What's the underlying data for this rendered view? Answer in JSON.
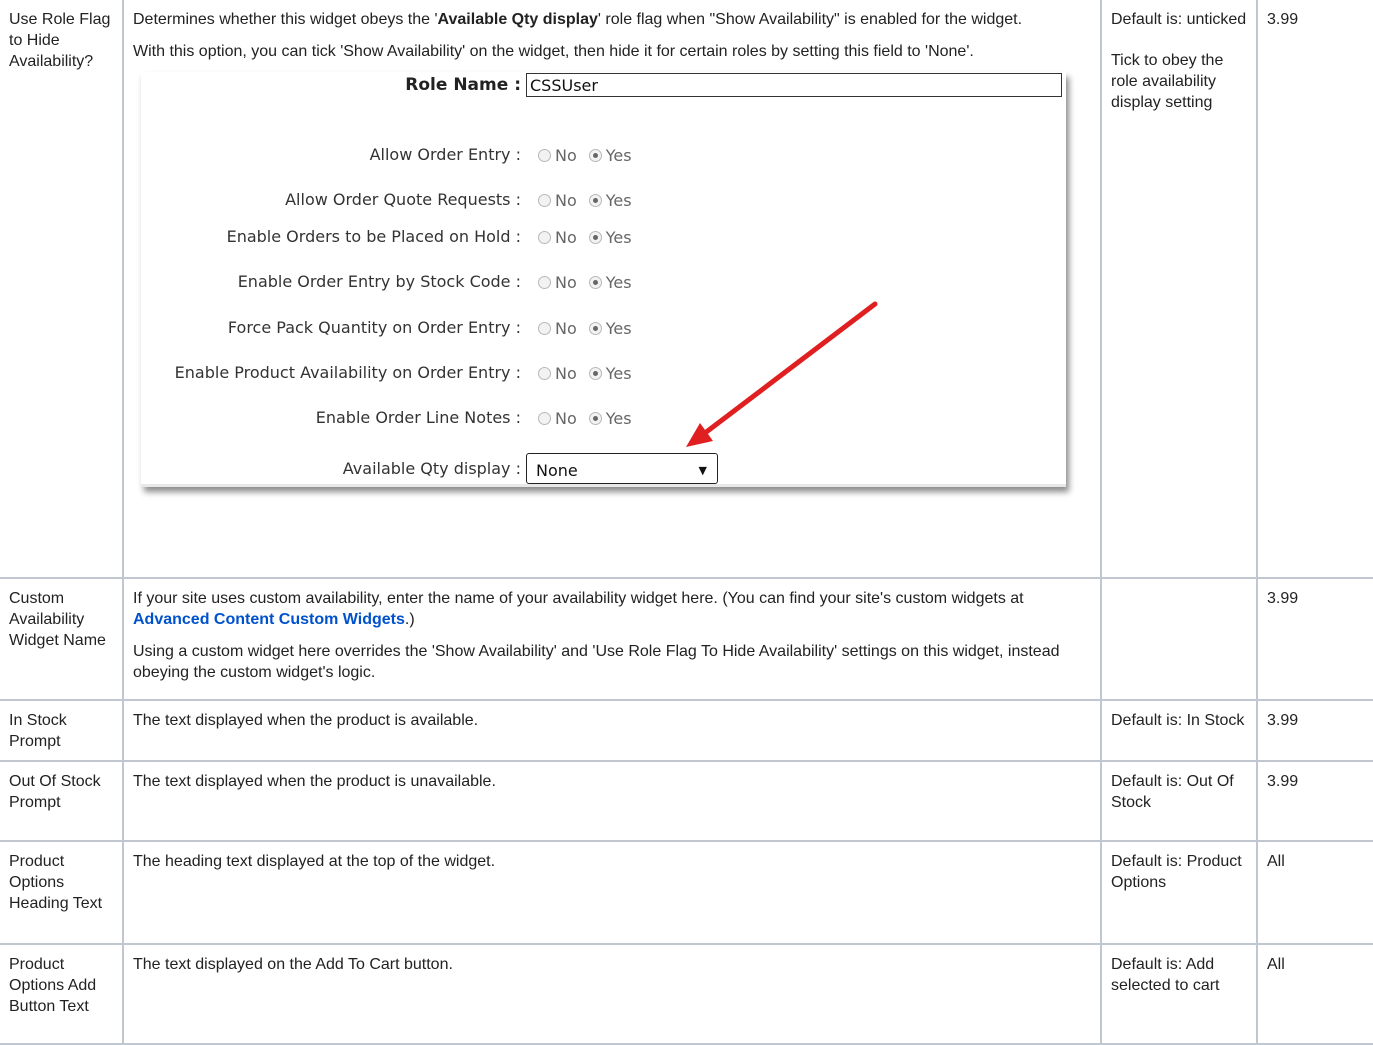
{
  "rows": [
    {
      "name": "Use Role Flag to Hide Availability?",
      "desc_p1_before": "Determines whether this widget obeys the '",
      "desc_p1_bold": "Available Qty display",
      "desc_p1_after": "' role flag when \"Show Availability\" is enabled for the widget.",
      "desc_p2": "With this option, you can tick 'Show Availability' on the widget, then hide it for certain roles by setting this field to 'None'.",
      "default_p1": "Default is: unticked",
      "default_p2": "Tick to obey the role availability display setting",
      "version": "3.99"
    },
    {
      "name": "Custom Availability Widget Name",
      "desc_p1_before": "If your site uses custom availability, enter the name of your availability widget here. (You can find your site's custom widgets at ",
      "desc_p1_link": "Advanced Content  Custom Widgets",
      "desc_p1_after": ".)",
      "desc_p2": "Using a custom widget here overrides the 'Show Availability' and 'Use Role Flag To Hide Availability' settings on this widget, instead obeying the custom widget's logic.",
      "default": "",
      "version": "3.99"
    },
    {
      "name": "In Stock Prompt",
      "desc": "The text displayed when the product is available.",
      "default": "Default is: In Stock",
      "version": "3.99"
    },
    {
      "name": "Out Of Stock Prompt",
      "desc": "The text displayed when the product is unavailable.",
      "default": "Default is: Out Of Stock",
      "version": "3.99"
    },
    {
      "name": "Product Options Heading Text",
      "desc": "The heading text displayed at the top of the widget.",
      "default": "Default is: Product Options",
      "version": "All"
    },
    {
      "name": "Product Options Add Button Text",
      "desc": "The text displayed on the Add To Cart button.",
      "default": "Default is: Add selected to cart",
      "version": "All"
    }
  ],
  "screenshot": {
    "role_name_label": "Role Name :",
    "role_name_value": "CSSUser",
    "option_no": "No",
    "option_yes": "Yes",
    "options": [
      {
        "label": "Allow Order Entry :",
        "selected": "Yes"
      },
      {
        "label": "Allow Order Quote Requests :",
        "selected": "Yes"
      },
      {
        "label": "Enable Orders to be Placed on Hold :",
        "selected": "Yes"
      },
      {
        "label": "Enable Order Entry by Stock Code :",
        "selected": "Yes"
      },
      {
        "label": "Force Pack Quantity on Order Entry  :",
        "selected": "Yes"
      },
      {
        "label": "Enable Product Availability on Order Entry :",
        "selected": "Yes"
      },
      {
        "label": "Enable Order Line Notes :",
        "selected": "Yes"
      }
    ],
    "qty_label": "Available Qty display :",
    "qty_value": "None",
    "arrow_color": "#e02020"
  },
  "colors": {
    "border": "#c1c7d0",
    "link": "#0052cc"
  }
}
